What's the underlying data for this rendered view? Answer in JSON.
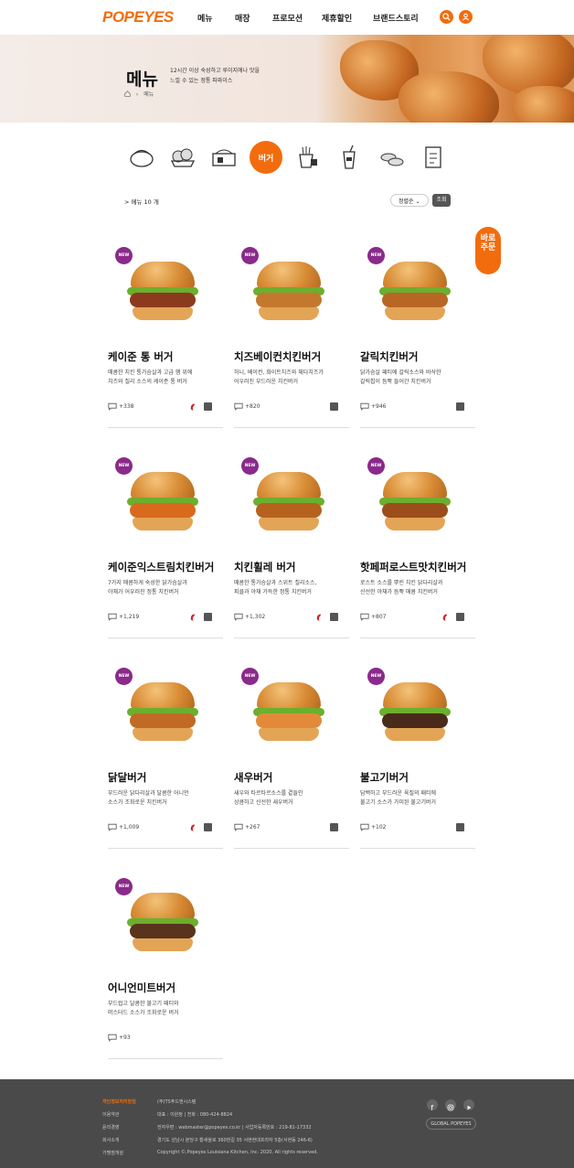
{
  "brand": {
    "logo": "POPEYES",
    "accent": "#f26c0d",
    "new_badge_color": "#8a2a8a"
  },
  "nav": {
    "items": [
      "메뉴",
      "매장",
      "프로모션",
      "제휴할인",
      "브랜드스토리"
    ]
  },
  "header_icons": [
    "search-icon",
    "user-icon"
  ],
  "hero": {
    "title": "메뉴",
    "desc_line1": "12시간 이상 숙성하고 루이지애나 맛을",
    "desc_line2": "느낄 수 있는 정통 파파이스",
    "breadcrumb_current": "메뉴"
  },
  "categories": {
    "icons": [
      "chicken-icon",
      "tenders-icon",
      "combo-box-icon",
      "fries-icon",
      "dessert-icon",
      "drink-icon",
      "sauce-icon",
      "checklist-icon"
    ],
    "active_label": "버거"
  },
  "listing": {
    "count_label": "> 메뉴 10 개",
    "sort_label": "정렬순",
    "search_label": "조회"
  },
  "quick_order": {
    "line1": "바로",
    "line2": "주문"
  },
  "new_badge": "NEW",
  "menu": [
    {
      "title": "케이준 통 버거",
      "desc1": "매콤한 치킨 통가슴살과 고급 햄 위에",
      "desc2": "치즈와 칠리 소스의 케이준 통 버거",
      "likes": "+338",
      "spicy": true
    },
    {
      "title": "치즈베이컨치킨버거",
      "desc1": "허니, 베이컨, 화이트치즈와 체다치즈가",
      "desc2": "어우러진 부드러운 치킨버거",
      "likes": "+820",
      "spicy": false
    },
    {
      "title": "갈릭치킨버거",
      "desc1": "닭가슴살 패티에 갈릭소스와 바삭한",
      "desc2": "갈릭칩이 듬뿍 들어간 치킨버거",
      "likes": "+946",
      "spicy": false
    },
    {
      "title": "케이준익스트림치킨버거",
      "desc1": "7가지 매콤하게 숙성한 닭가슴살과",
      "desc2": "야채가 어우러진 정통 치킨버거",
      "likes": "+1,219",
      "spicy": true
    },
    {
      "title": "치킨휠레 버거",
      "desc1": "매콤한 통가슴살과 스위트 칠리소스,",
      "desc2": "피클과 야채 가득한 정통 치킨버거",
      "likes": "+1,302",
      "spicy": true
    },
    {
      "title": "핫페퍼로스트맛치킨버거",
      "desc1": "로스트 소스를 뿌린 치킨 닭다리살과",
      "desc2": "신선한 야채가 듬뿍 매콤 치킨버거",
      "likes": "+807",
      "spicy": true
    },
    {
      "title": "닭달버거",
      "desc1": "부드러운 닭다리살과 달콤한 어니언",
      "desc2": "소스가 조화로운 치킨버거",
      "likes": "+1,009",
      "spicy": true
    },
    {
      "title": "새우버거",
      "desc1": "새우와 타르타르소스를 곁들인",
      "desc2": "상큼하고 신선한 새우버거",
      "likes": "+267",
      "spicy": false
    },
    {
      "title": "불고기버거",
      "desc1": "담백하고 부드러운 육질의 패티에",
      "desc2": "불고기 소스가 가미된 불고기버거",
      "likes": "+102",
      "spicy": false
    },
    {
      "title": "어니언미트버거",
      "desc1": "부드럽고 달콤한 불고기 패티와",
      "desc2": "머스터드 소스가 조화로운 버거",
      "likes": "+93",
      "spicy": false
    }
  ],
  "footer": {
    "links": [
      "개인정보처리방침",
      "이용약관",
      "윤리경영",
      "회사소개",
      "가맹점개설"
    ],
    "company": "(주)TS푸드앤시스템",
    "line1": "대표 : 이원정   |   전화 : 080-424-8824",
    "line2": "전자우편 : webmaster@popeyes.co.kr   |   사업자등록번호 : 219-81-17332",
    "line3": "경기도 성남시 분당구 황새울로 360번길 35 서현현대프라자 5층(서현동 246-6)",
    "copyright": "Copyright ©,Popeyes Louisiana Kitchen, Inc. 2020. All rights reserved.",
    "social": [
      "facebook-icon",
      "instagram-icon",
      "youtube-icon"
    ],
    "global_label": "GLOBAL POPEYES"
  }
}
